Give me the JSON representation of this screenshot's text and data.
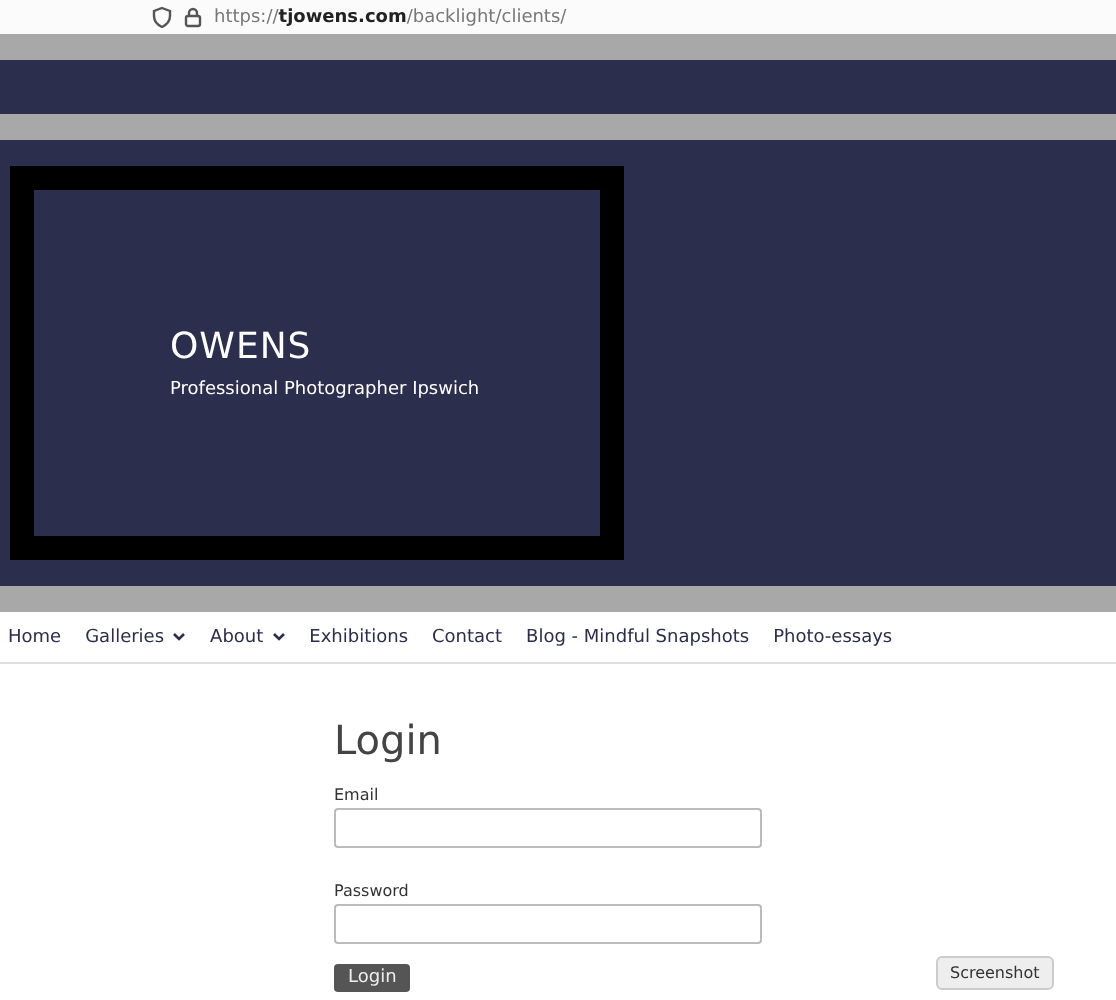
{
  "browser": {
    "url_prefix": "https://",
    "url_domain": "tjowens.com",
    "url_path": "/backlight/clients/"
  },
  "banner": {
    "title": "OWENS",
    "subtitle": "Professional Photographer Ipswich"
  },
  "nav": [
    {
      "label": "Home",
      "has_menu": false
    },
    {
      "label": "Galleries",
      "has_menu": true
    },
    {
      "label": "About",
      "has_menu": true
    },
    {
      "label": "Exhibitions",
      "has_menu": false
    },
    {
      "label": "Contact",
      "has_menu": false
    },
    {
      "label": "Blog - Mindful Snapshots",
      "has_menu": false
    },
    {
      "label": "Photo-essays",
      "has_menu": false
    }
  ],
  "login": {
    "heading": "Login",
    "fields": [
      {
        "label": "Email"
      },
      {
        "label": "Password"
      }
    ],
    "button": "Login"
  },
  "tooltip": "Screenshot"
}
